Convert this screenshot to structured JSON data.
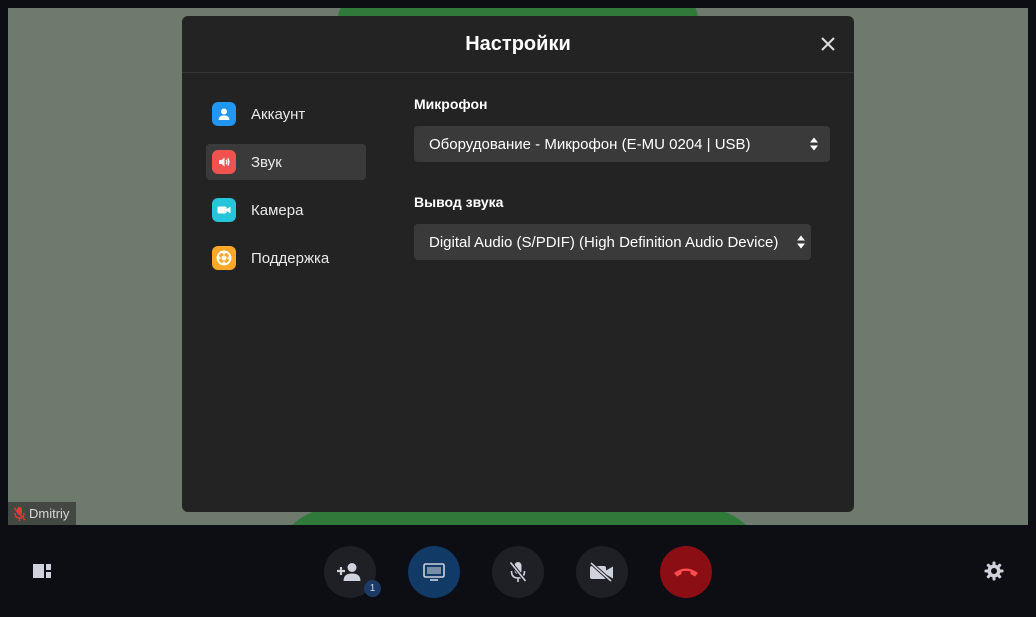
{
  "participant": {
    "name": "Dmitriy",
    "mic_icon": "mic-off-icon"
  },
  "settings": {
    "title": "Настройки",
    "close_icon": "close-icon",
    "nav": [
      {
        "label": "Аккаунт",
        "icon": "user-icon",
        "color": "#2196f3",
        "active": false
      },
      {
        "label": "Звук",
        "icon": "speaker-icon",
        "color": "#ef5350",
        "active": true
      },
      {
        "label": "Камера",
        "icon": "camera-icon",
        "color": "#26c6da",
        "active": false
      },
      {
        "label": "Поддержка",
        "icon": "lifebuoy-icon",
        "color": "#ffa726",
        "active": false
      }
    ],
    "microphone": {
      "label": "Микрофон",
      "value": "Оборудование - Микрофон (E-MU 0204 | USB)"
    },
    "output": {
      "label": "Вывод звука",
      "value": "Digital Audio (S/PDIF) (High Definition Audio Device)"
    }
  },
  "toolbar": {
    "invite_badge": "1",
    "buttons": [
      "layout-icon",
      "add-user-icon",
      "screen-share-icon",
      "mic-off-icon",
      "camera-off-icon",
      "hang-up-icon",
      "gear-icon"
    ],
    "colors": {
      "screen_share": "#113a66",
      "hang_up": "#8a0e14"
    }
  }
}
